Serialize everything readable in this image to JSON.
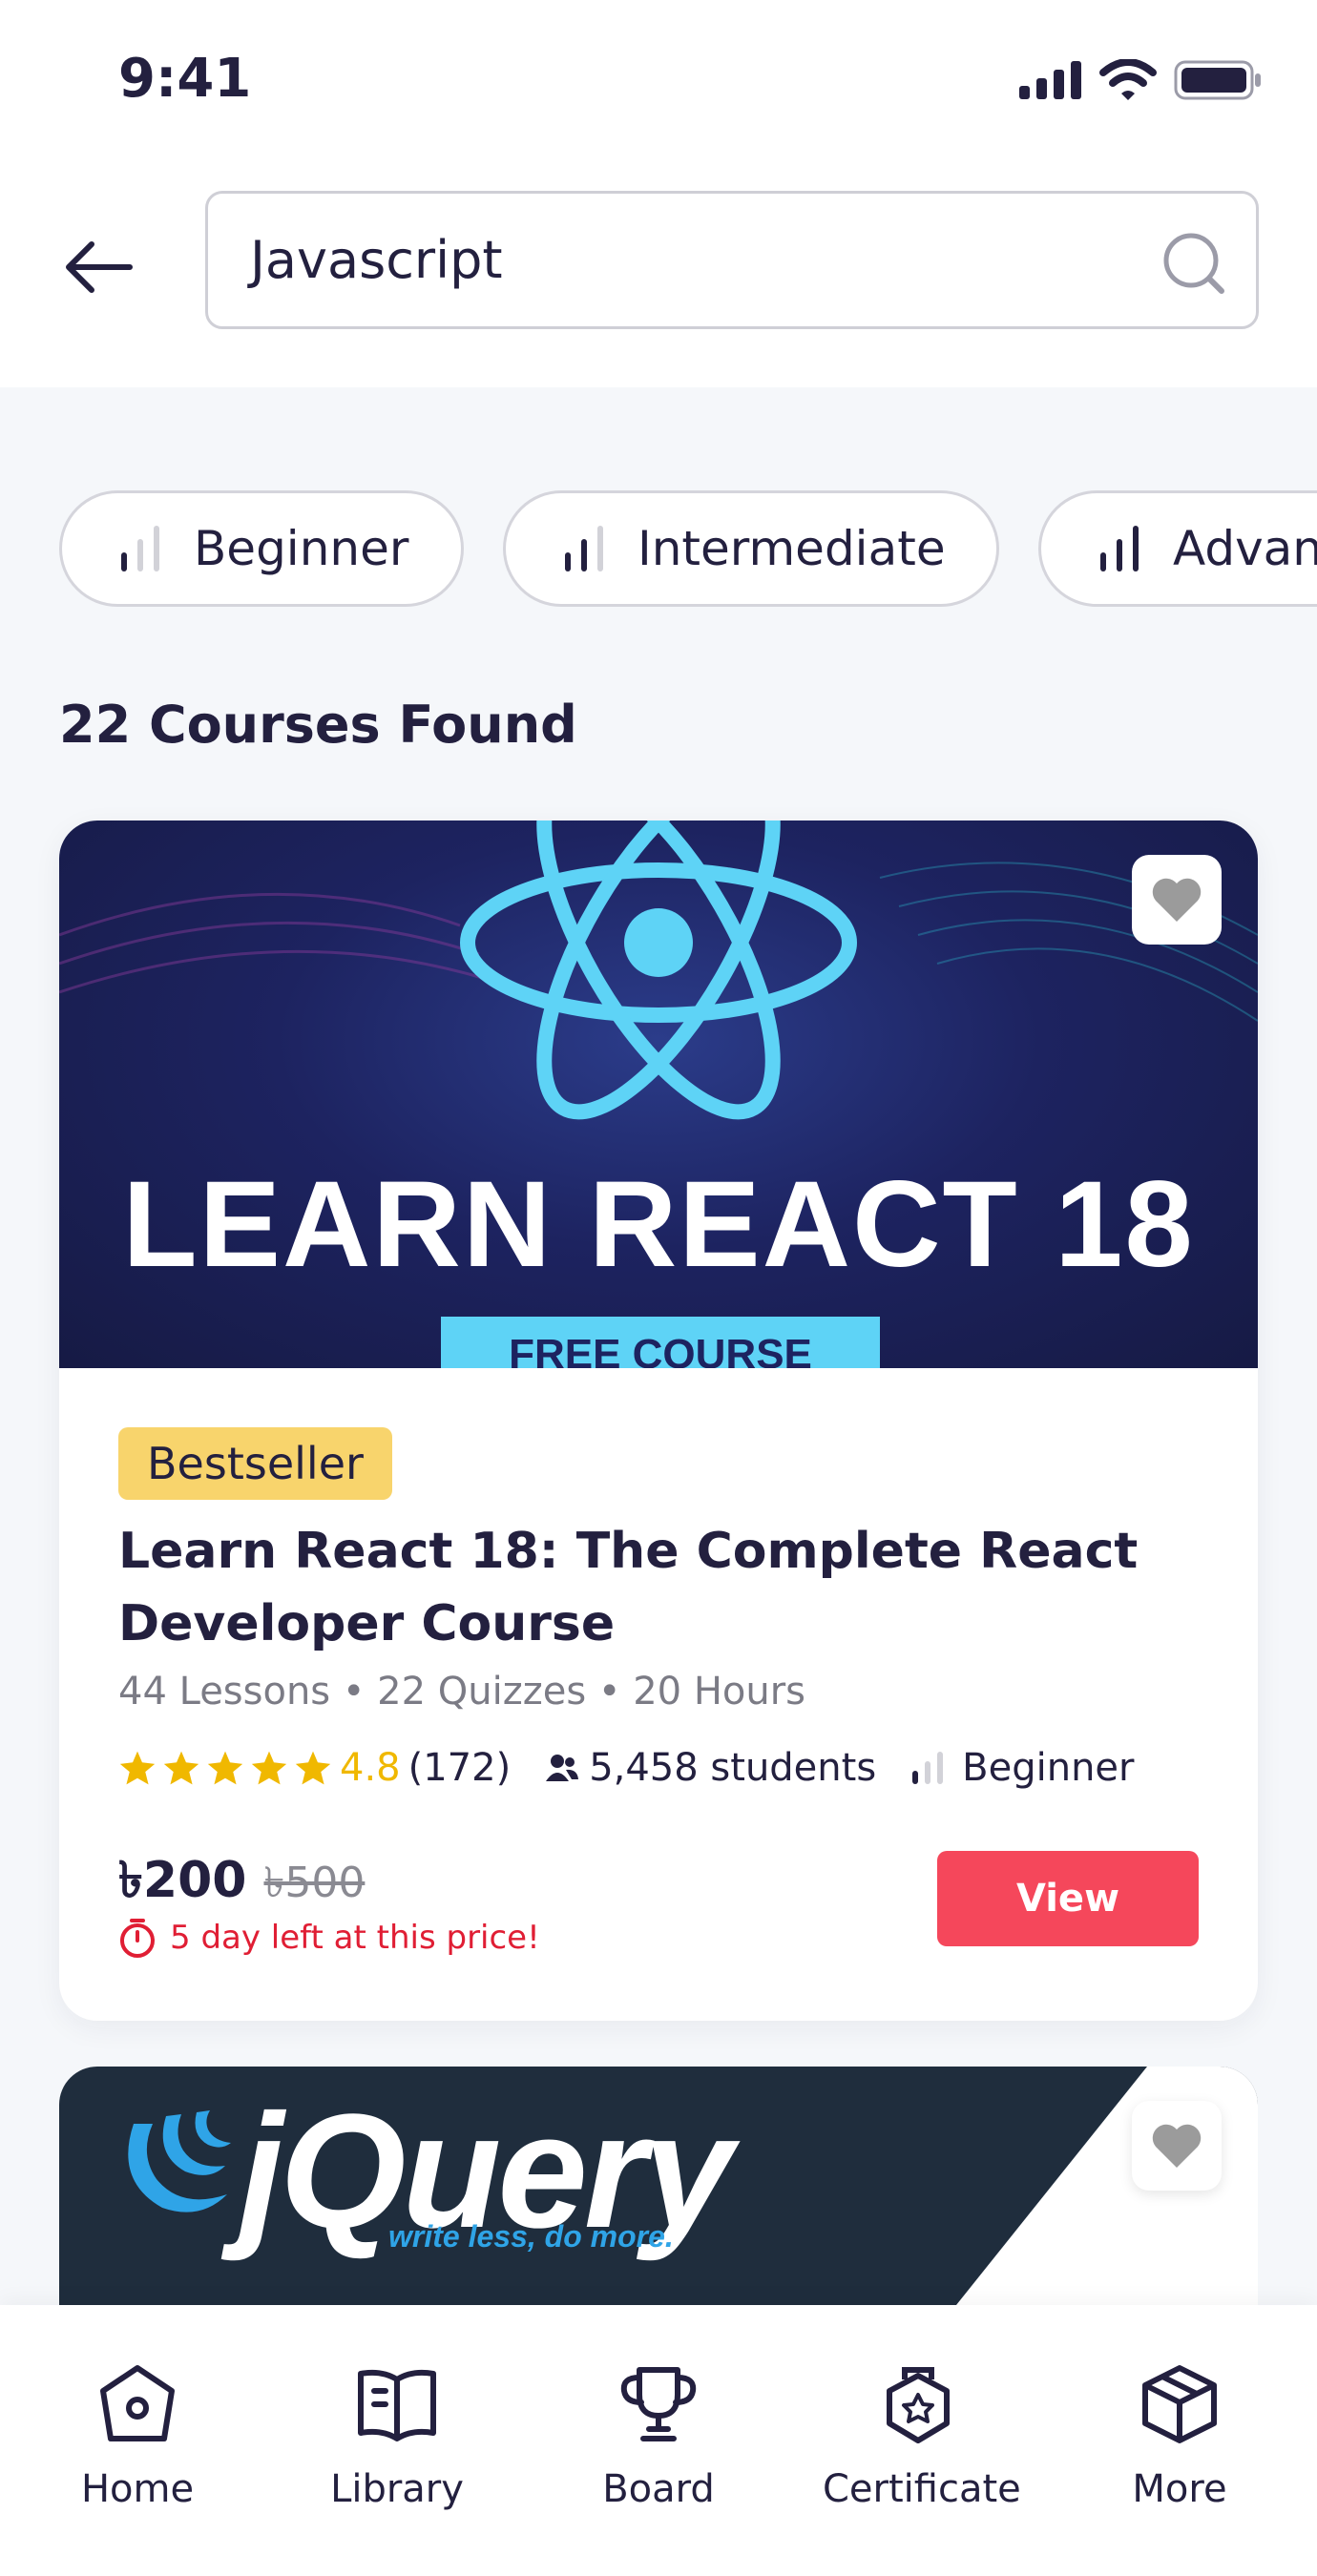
{
  "status_bar": {
    "time": "9:41"
  },
  "search": {
    "value": "Javascript"
  },
  "filters": [
    {
      "label": "Beginner",
      "level": 1
    },
    {
      "label": "Intermediate",
      "level": 2
    },
    {
      "label": "Advanced",
      "level": 3
    }
  ],
  "results": {
    "count_text": "22 Courses Found"
  },
  "course": {
    "banner_title": "LEARN REACT 18",
    "banner_subtitle": "FREE COURSE",
    "badge": "Bestseller",
    "title": "Learn React 18: The Complete React Developer Course",
    "meta": "44 Lessons • 22 Quizzes • 20 Hours",
    "rating": "4.8",
    "reviews": "(172)",
    "students": "5,458 students",
    "level": "Beginner",
    "price": "৳200",
    "old_price": "৳500",
    "deadline": "5 day left at this price!",
    "view_label": "View"
  },
  "course2": {
    "logo": "jQuery",
    "tagline": "write less, do more."
  },
  "tabs": [
    {
      "label": "Home",
      "icon": "home-icon"
    },
    {
      "label": "Library",
      "icon": "book-icon"
    },
    {
      "label": "Board",
      "icon": "trophy-icon"
    },
    {
      "label": "Certificate",
      "icon": "certificate-icon"
    },
    {
      "label": "More",
      "icon": "cube-icon"
    }
  ],
  "colors": {
    "accent": "#f5475b",
    "badge": "#f8d46c",
    "star": "#f0b800",
    "deadline": "#e01e34",
    "text": "#23203f"
  }
}
